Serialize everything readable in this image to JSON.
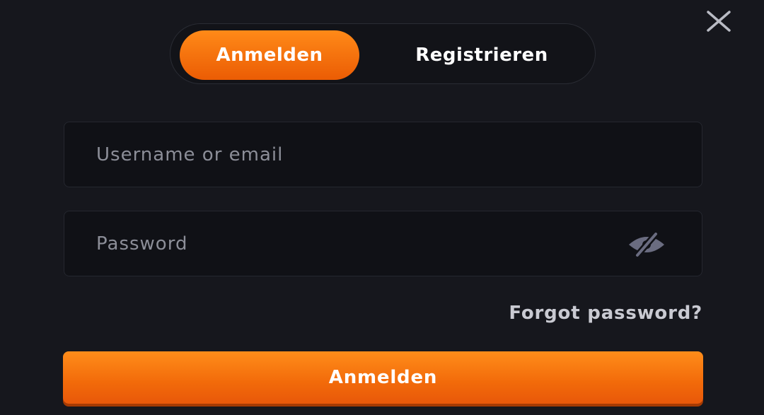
{
  "tabs": {
    "login_label": "Anmelden",
    "register_label": "Registrieren",
    "active": "login"
  },
  "form": {
    "username_placeholder": "Username or email",
    "username_value": "",
    "password_placeholder": "Password",
    "password_value": "",
    "forgot_label": "Forgot password?",
    "submit_label": "Anmelden"
  },
  "icons": {
    "close": "close-icon",
    "password_toggle": "eye-off-icon"
  },
  "colors": {
    "background": "#16171d",
    "accent": "#f57a10",
    "input_background": "#101116",
    "placeholder": "#8c8e98",
    "icon": "#6a6c80"
  }
}
